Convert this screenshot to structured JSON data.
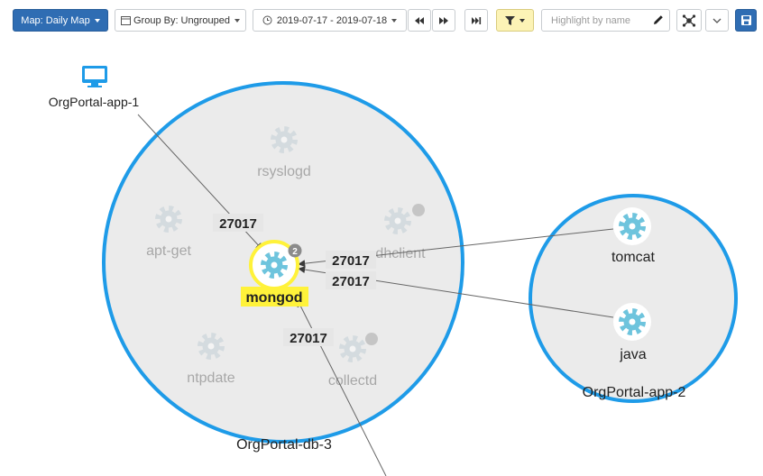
{
  "toolbar": {
    "map_button": "Map: Daily Map",
    "group_by": "Group By: Ungrouped",
    "date_range": "2019-07-17 - 2019-07-18",
    "highlight_placeholder": "Highlight by name"
  },
  "colors": {
    "primary": "#2f6db3",
    "circle_stroke": "#1e9be8",
    "process_icon": "#6ec4dd",
    "highlight": "#fff23a"
  },
  "map": {
    "hosts": [
      {
        "name": "OrgPortal-app-1",
        "icon": "monitor-icon"
      },
      {
        "name": "OrgPortal-db-3"
      },
      {
        "name": "OrgPortal-app-2"
      }
    ],
    "processes": {
      "rsyslogd": "rsyslogd",
      "apt_get": "apt-get",
      "dhclient": "dhclient",
      "mongod": "mongod",
      "ntpdate": "ntpdate",
      "collectd": "collectd",
      "tomcat": "tomcat",
      "java": "java"
    },
    "mongod_badge": "2",
    "ports": {
      "app1_to_mongod": "27017",
      "tomcat_to_mongod": "27017",
      "java_to_mongod": "27017",
      "external_to_mongod": "27017"
    }
  }
}
